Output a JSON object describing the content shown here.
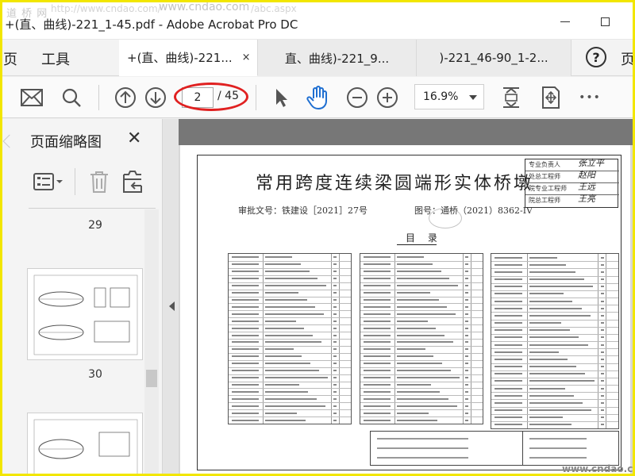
{
  "watermark": {
    "site": "道 桥 网",
    "site_url": "www.cndao.com",
    "url_fragment": "http://www.cndao.com/",
    "url_fragment_2": "/abc.aspx"
  },
  "window": {
    "title": "+(直、曲线)-221_1-45.pdf - Adobe Acrobat Pro DC"
  },
  "nav": {
    "page": "页",
    "tools": "工具"
  },
  "tabs": [
    {
      "label": "+(直、曲线)-221...",
      "close": "×",
      "active": true
    },
    {
      "label": "直、曲线)-221_9..."
    },
    {
      "label": ")-221_46-90_1-2..."
    }
  ],
  "help_label": "?",
  "tab_edge_label": "页",
  "toolbar": {
    "current_page": "2",
    "total_pages": "/ 45",
    "zoom": "16.9%",
    "more": "•••",
    "icons": [
      "mail-icon",
      "search-icon",
      "page-up-icon",
      "page-down-icon",
      "select-cursor-icon",
      "hand-tool-icon",
      "zoom-out-icon",
      "zoom-in-icon",
      "fit-page-icon",
      "fullscreen-icon",
      "more-icon"
    ]
  },
  "sidebar": {
    "title": "页面缩略图",
    "close": "✕",
    "thumbnails": [
      {
        "number": "29"
      },
      {
        "number": "30"
      }
    ]
  },
  "document": {
    "title": "常用跨度连续梁圆端形实体桥墩",
    "approval": "审批文号：铁建设［2021］27号",
    "figure_no": "图号：通桥（2021）8362-IV",
    "toc_heading": "目 录",
    "signature_rows": [
      {
        "role": "专业负责人",
        "signature": "张立平"
      },
      {
        "role": "处总工程师",
        "signature": "赵阳"
      },
      {
        "role": "院专业工程师",
        "signature": "王远"
      },
      {
        "role": "院总工程师",
        "signature": "王亮"
      }
    ],
    "footer_watermark": "www.cndao.com"
  },
  "colors": {
    "accent_red": "#e02020",
    "frame_yellow": "#f2e600",
    "icon_gray": "#555555"
  }
}
